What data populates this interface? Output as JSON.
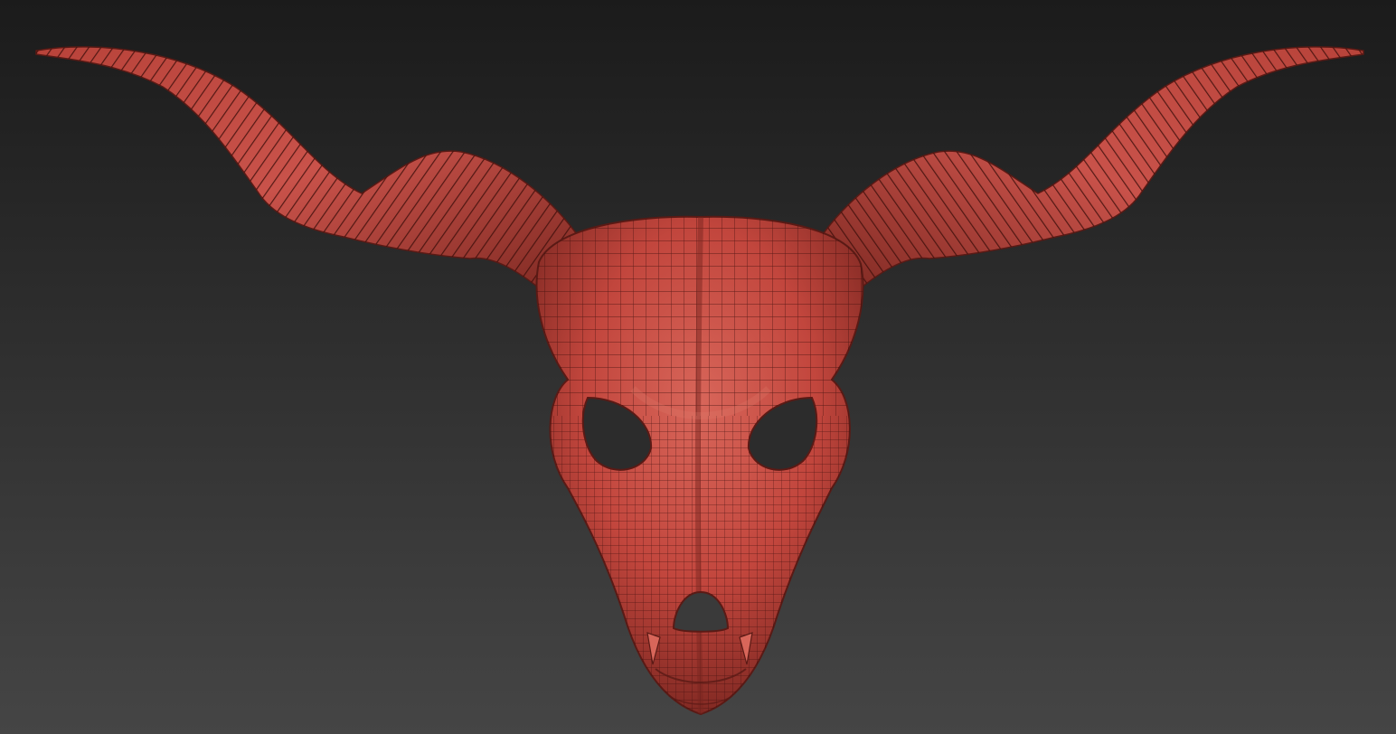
{
  "viewport": {
    "background_top": "#1b1b1b",
    "background_bottom": "#454545"
  },
  "model": {
    "subject": "horned-skull-mask",
    "render_mode": "polyframe-wireframe-overlay",
    "material_color": "#c2463d",
    "material_highlight": "#d8665a",
    "material_shadow": "#5e1d19",
    "wire_color": "#3a0d0b"
  }
}
